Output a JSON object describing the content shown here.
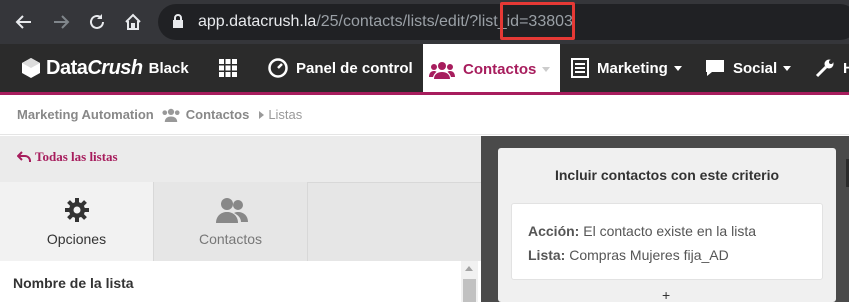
{
  "browser": {
    "url_host": "app.datacrush.la",
    "url_path": "/25/contacts/lists/edit/?list_id=33803",
    "icons": [
      "back-arrow-icon",
      "forward-arrow-icon",
      "reload-icon",
      "home-icon",
      "lock-icon"
    ],
    "highlight_color": "#e53935"
  },
  "app": {
    "logo_main": "Data",
    "logo_italic": "Crush",
    "logo_suffix": "Black",
    "brand_color": "#a71d5d",
    "nav": [
      {
        "label": "Panel de control",
        "icon": "dashboard-icon"
      },
      {
        "label": "Contactos",
        "icon": "users-icon",
        "active": true
      },
      {
        "label": "Marketing",
        "icon": "newspaper-icon"
      },
      {
        "label": "Social",
        "icon": "chat-icon"
      },
      {
        "label": "H",
        "icon": "wrench-icon"
      }
    ]
  },
  "breadcrumb": {
    "root": "Marketing Automation",
    "section": "Contactos",
    "current": "Listas"
  },
  "left": {
    "back_link": "Todas las listas",
    "tabs": [
      {
        "label": "Opciones",
        "icon": "gear-icon",
        "active": true
      },
      {
        "label": "Contactos",
        "icon": "users-icon",
        "active": false
      }
    ],
    "list_name_label": "Nombre de la lista"
  },
  "right": {
    "card_title": "Incluir contactos con este criterio",
    "rule": {
      "action_label": "Acción:",
      "action_value": "El contacto existe en la lista",
      "list_label": "Lista:",
      "list_value": "Compras Mujeres fija_AD"
    },
    "add_symbol": "+"
  }
}
